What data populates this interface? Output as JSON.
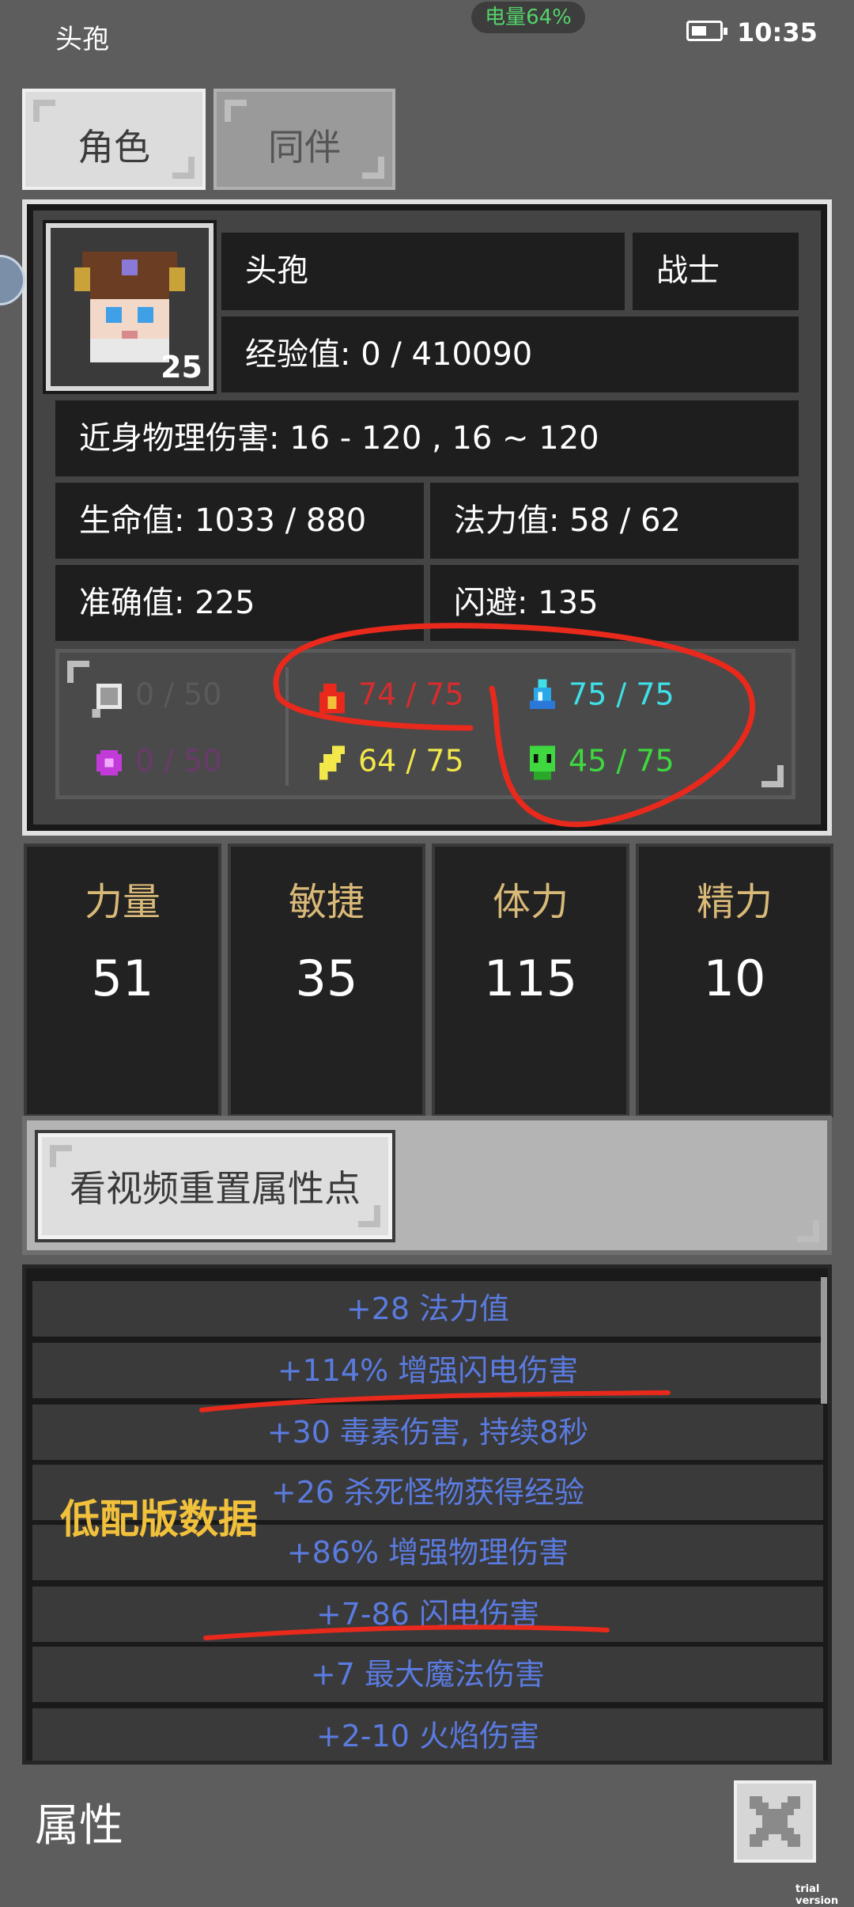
{
  "status_bar": {
    "app_name": "头孢",
    "battery_pill": "电量64%",
    "time": "10:35"
  },
  "tabs": [
    {
      "label": "角色",
      "active": true
    },
    {
      "label": "同伴",
      "active": false
    }
  ],
  "character": {
    "name": "头孢",
    "class": "战士",
    "level": "25",
    "exp": "经验值: 0 / 410090",
    "melee_damage": "近身物理伤害: 16 - 120 , 16 ~ 120",
    "hp": "生命值: 1033 / 880",
    "mp": "法力值: 58 / 62",
    "accuracy": "准确值: 225",
    "dodge": "闪避: 135"
  },
  "resistances": [
    {
      "icon": "physical-shield-icon",
      "value": "0 / 50",
      "color": "#5a5a5a"
    },
    {
      "icon": "arcane-orb-icon",
      "value": "0 / 50",
      "color": "#6b3a6b"
    },
    {
      "icon": "fire-icon",
      "value": "74 / 75",
      "color": "#d92c2c"
    },
    {
      "icon": "lightning-icon",
      "value": "64 / 75",
      "color": "#f2e84a"
    },
    {
      "icon": "ice-crystal-icon",
      "value": "75 / 75",
      "color": "#3fe0e8"
    },
    {
      "icon": "poison-skull-icon",
      "value": "45 / 75",
      "color": "#3fd83f"
    }
  ],
  "attributes": [
    {
      "label": "力量",
      "value": "51"
    },
    {
      "label": "敏捷",
      "value": "35"
    },
    {
      "label": "体力",
      "value": "115"
    },
    {
      "label": "精力",
      "value": "10"
    }
  ],
  "reset_button": "看视频重置属性点",
  "bonuses": [
    "+28 法力值",
    "+114% 增强闪电伤害",
    "+30 毒素伤害, 持续8秒",
    "+26 杀死怪物获得经验",
    "+86% 增强物理伤害",
    "+7-86 闪电伤害",
    "+7 最大魔法伤害",
    "+2-10 火焰伤害"
  ],
  "watermark": "低配版数据",
  "footer": {
    "title": "属性",
    "close_icon": "close-x-icon"
  },
  "trial_note": "trial version",
  "colors": {
    "gold_label": "#d9b978",
    "bonus_text": "#5a7be0",
    "annotation_red": "#e8291c"
  }
}
